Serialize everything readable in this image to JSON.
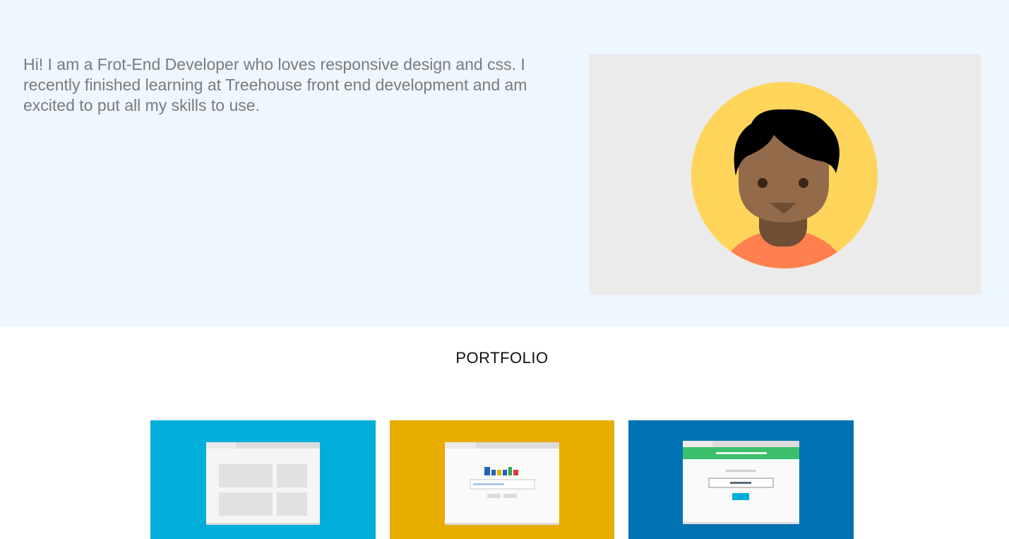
{
  "about": {
    "intro": "Hi! I am a Frot-End Developer who loves responsive design and css. I recently finished learning at Treehouse front end development and am excited to put all my skills to use.",
    "avatar_icon": "developer-avatar-illustration"
  },
  "portfolio": {
    "title": "PORTFOLIO",
    "projects": [
      {
        "icon": "layout-grid-thumbnail-icon",
        "color": "#00aed9"
      },
      {
        "icon": "search-page-thumbnail-icon",
        "color": "#e6ac00"
      },
      {
        "icon": "signup-form-thumbnail-icon",
        "color": "#0071b2"
      }
    ]
  },
  "colors": {
    "hero_bg": "#eef6fe",
    "intro_text": "#7b7b7b",
    "avatar_bg": "#ebebeb",
    "avatar_circle": "#fed55a",
    "skin": "#946b4a",
    "hair": "#000000",
    "shirt": "#ff7f4f"
  }
}
